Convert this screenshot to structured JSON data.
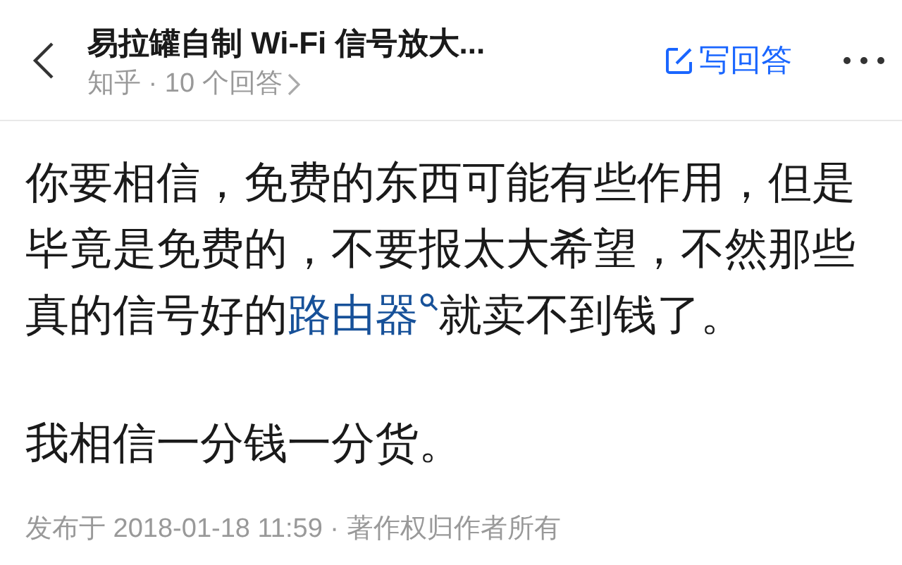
{
  "header": {
    "title": "易拉罐自制 Wi-Fi 信号放大...",
    "subtitle": "知乎 · 10 个回答",
    "write_answer": "写回答"
  },
  "answer": {
    "paragraphs": [
      {
        "before": "你要相信，免费的东西可能有些作用，但是毕竟是免费的，不要报太大希望，不然那些真的信号好的",
        "link": "路由器",
        "after": "就卖不到钱了。"
      },
      {
        "before": "我相信一分钱一分货。"
      }
    ],
    "footer": "发布于 2018-01-18 11:59 · 著作权归作者所有"
  }
}
